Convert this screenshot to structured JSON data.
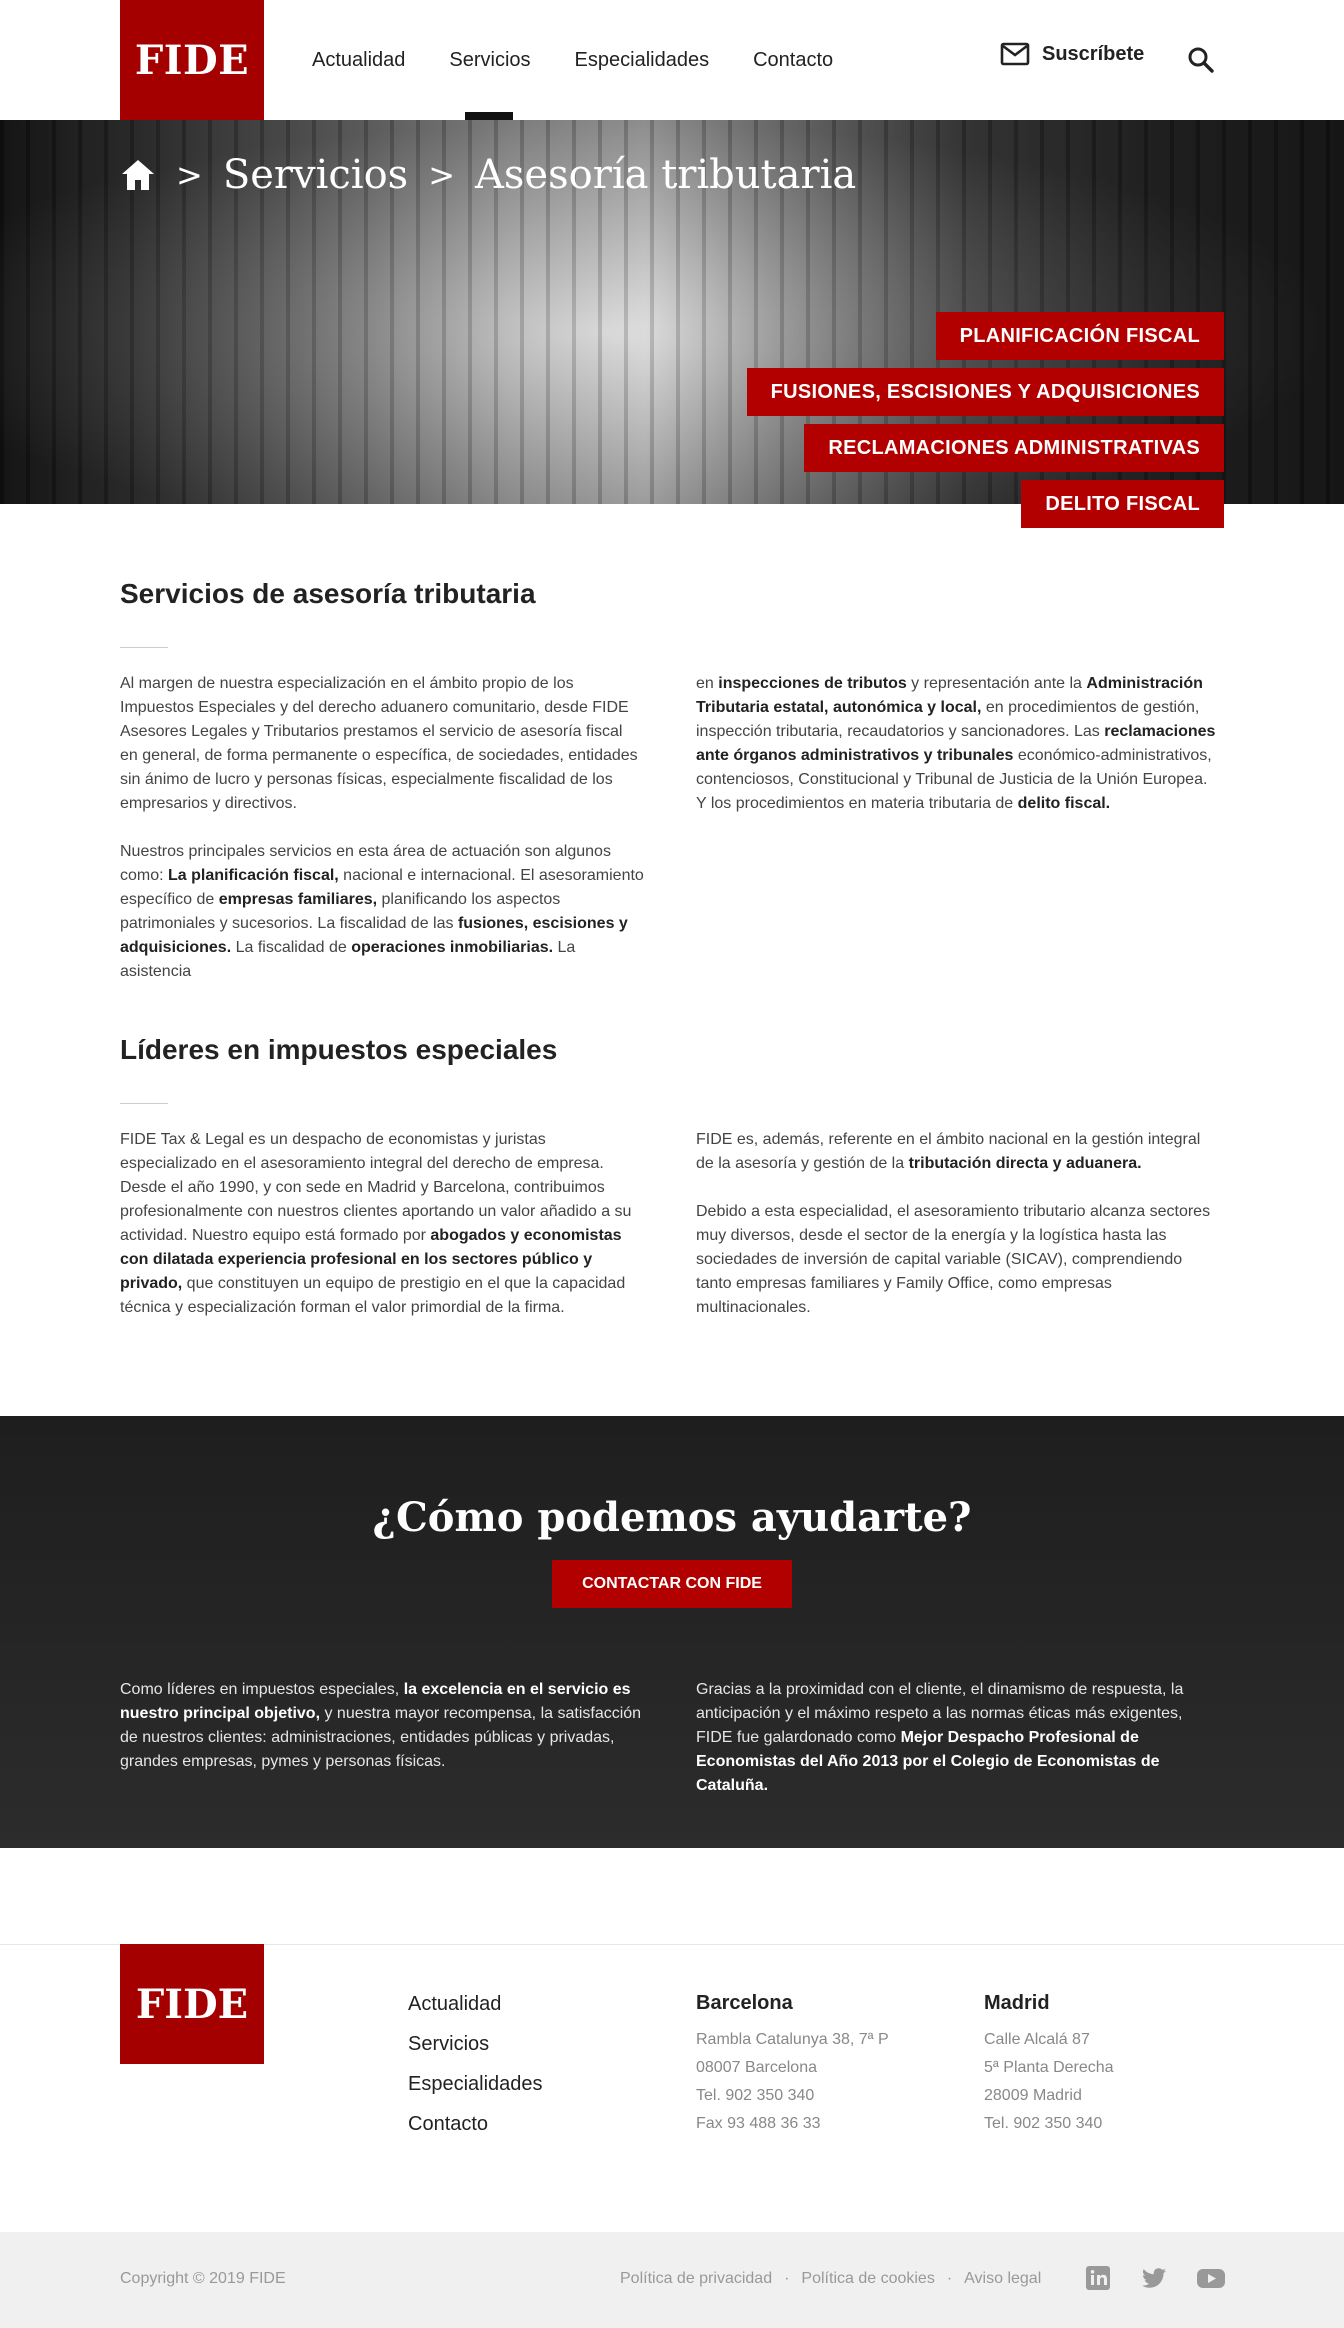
{
  "header": {
    "logo": "FIDE",
    "nav": [
      "Actualidad",
      "Servicios",
      "Especialidades",
      "Contacto"
    ],
    "active_nav": "Servicios",
    "subscribe_label": "Suscríbete"
  },
  "hero": {
    "breadcrumb": [
      "Servicios",
      "Asesoría tributaria"
    ],
    "tags": [
      "PLANIFICACIÓN FISCAL",
      "FUSIONES, ESCISIONES Y ADQUISICIONES",
      "RECLAMACIONES ADMINISTRATIVAS",
      "DELITO FISCAL"
    ]
  },
  "section1": {
    "title": "Servicios de asesoría tributaria",
    "left_p1": "Al margen de nuestra especialización en el ámbito propio de los Impuestos Especiales y del derecho aduanero comunitario, desde FIDE Asesores Legales y Tributarios prestamos el servicio de asesoría fiscal en general, de forma permanente o específica, de sociedades, entidades sin ánimo de lucro y personas físicas, especialmente fiscalidad de los empresarios y directivos.",
    "left_p2": [
      {
        "t": "Nuestros principales servicios en esta área de actuación son algunos como: "
      },
      {
        "t": "La planificación fiscal,",
        "b": true
      },
      {
        "t": " nacional e internacional. El asesoramiento específico de "
      },
      {
        "t": "empresas familiares,",
        "b": true
      },
      {
        "t": " planificando los aspectos patrimoniales y sucesorios. La fiscalidad de las "
      },
      {
        "t": "fusiones, escisiones y adquisiciones.",
        "b": true
      },
      {
        "t": " La fiscalidad de "
      },
      {
        "t": "operaciones inmobiliarias.",
        "b": true
      },
      {
        "t": " La asistencia"
      }
    ],
    "right_p1": [
      {
        "t": "en "
      },
      {
        "t": "inspecciones de tributos",
        "b": true
      },
      {
        "t": " y representación ante la "
      },
      {
        "t": "Administración Tributaria estatal, autonómica y local,",
        "b": true
      },
      {
        "t": " en procedimientos de gestión, inspección tributaria, recaudatorios y sancionadores. Las "
      },
      {
        "t": "reclamaciones ante órganos administrativos y tribunales",
        "b": true
      },
      {
        "t": " económico-administrativos, contenciosos, Constitucional y Tribunal de Justicia de la Unión Europea. Y los procedimientos en materia tributaria de "
      },
      {
        "t": "delito fiscal.",
        "b": true
      }
    ]
  },
  "section2": {
    "title": "Líderes en impuestos especiales",
    "left_p1": [
      {
        "t": "FIDE Tax & Legal es un despacho de economistas y juristas especializado en el asesoramiento integral del derecho de empresa. Desde el año 1990, y con sede en Madrid y Barcelona, contribuimos profesionalmente con nuestros clientes aportando un valor añadido a su actividad. Nuestro equipo está formado por "
      },
      {
        "t": "abogados y economistas con dilatada experiencia profesional en los sectores público y privado,",
        "b": true
      },
      {
        "t": " que constituyen un equipo de prestigio en el que la capacidad técnica y especialización forman el valor primordial de la firma."
      }
    ],
    "right_p1": [
      {
        "t": "FIDE es, además, referente en el ámbito nacional en la gestión integral de la asesoría y gestión de la "
      },
      {
        "t": "tributación directa y aduanera.",
        "b": true
      }
    ],
    "right_p2": "Debido a esta especialidad, el asesoramiento tributario alcanza sectores muy diversos, desde el sector de la energía y la logística hasta las sociedades de inversión de capital variable (SICAV), comprendiendo tanto empresas familiares y Family Office, como empresas multinacionales."
  },
  "cta": {
    "title": "¿Cómo podemos ayudarte?",
    "button": "CONTACTAR CON FIDE",
    "left": [
      {
        "t": "Como líderes en impuestos especiales, "
      },
      {
        "t": "la excelencia en el servicio es nuestro principal objetivo,",
        "b": true
      },
      {
        "t": " y nuestra mayor recompensa, la satisfacción de nuestros clientes: administraciones, entidades públicas y privadas, grandes empresas, pymes y personas físicas."
      }
    ],
    "right": [
      {
        "t": "Gracias a la proximidad con el cliente, el dinamismo de respuesta, la anticipación y el máximo respeto a las normas éticas más exigentes, FIDE fue galardonado como "
      },
      {
        "t": "Mejor Despacho Profesional de Economistas del Año 2013 por el Colegio de Economistas de Cataluña.",
        "b": true
      }
    ]
  },
  "footer": {
    "logo": "FIDE",
    "nav": [
      "Actualidad",
      "Servicios",
      "Especialidades",
      "Contacto"
    ],
    "barcelona": {
      "title": "Barcelona",
      "lines": [
        "Rambla Catalunya 38, 7ª P",
        "08007 Barcelona",
        "Tel. 902 350 340",
        "Fax 93 488 36 33"
      ]
    },
    "madrid": {
      "title": "Madrid",
      "lines": [
        "Calle Alcalá 87",
        "5ª Planta Derecha",
        "28009 Madrid",
        "Tel. 902 350 340"
      ]
    },
    "copyright": "Copyright © 2019 FIDE",
    "legal": [
      "Política de privacidad",
      "Política de cookies",
      "Aviso legal"
    ],
    "social": [
      "linkedin-icon",
      "twitter-icon",
      "youtube-icon"
    ]
  },
  "colors": {
    "brand": "#a50000",
    "tag": "#b20000",
    "dark_band": "#262626"
  }
}
